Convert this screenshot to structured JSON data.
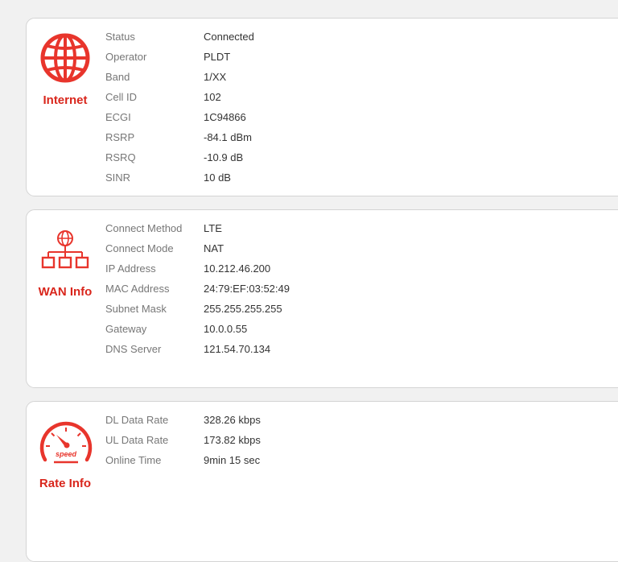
{
  "colors": {
    "accent": "#d9261c",
    "label": "#777777",
    "value": "#333333",
    "background": "#f1f1f1"
  },
  "internet": {
    "title": "Internet",
    "icon": "globe-icon",
    "rows": [
      {
        "label": "Status",
        "value": "Connected"
      },
      {
        "label": "Operator",
        "value": "PLDT"
      },
      {
        "label": "Band",
        "value": "1/XX"
      },
      {
        "label": "Cell ID",
        "value": "102"
      },
      {
        "label": "ECGI",
        "value": "1C94866"
      },
      {
        "label": "RSRP",
        "value": "-84.1 dBm"
      },
      {
        "label": "RSRQ",
        "value": "-10.9 dB"
      },
      {
        "label": "SINR",
        "value": "10 dB"
      }
    ]
  },
  "wan": {
    "title": "WAN Info",
    "icon": "network-topology-icon",
    "rows": [
      {
        "label": "Connect Method",
        "value": "LTE"
      },
      {
        "label": "Connect Mode",
        "value": "NAT"
      },
      {
        "label": "IP Address",
        "value": "10.212.46.200"
      },
      {
        "label": "MAC Address",
        "value": "24:79:EF:03:52:49"
      },
      {
        "label": "Subnet Mask",
        "value": "255.255.255.255"
      },
      {
        "label": "Gateway",
        "value": "10.0.0.55"
      },
      {
        "label": "DNS Server",
        "value": "121.54.70.134"
      }
    ]
  },
  "rate": {
    "title": "Rate Info",
    "icon": "speedometer-icon",
    "gauge_text": "speed",
    "rows": [
      {
        "label": "DL Data Rate",
        "value": "328.26 kbps"
      },
      {
        "label": "UL Data Rate",
        "value": "173.82 kbps"
      },
      {
        "label": "Online Time",
        "value": "9min 15 sec"
      }
    ]
  }
}
